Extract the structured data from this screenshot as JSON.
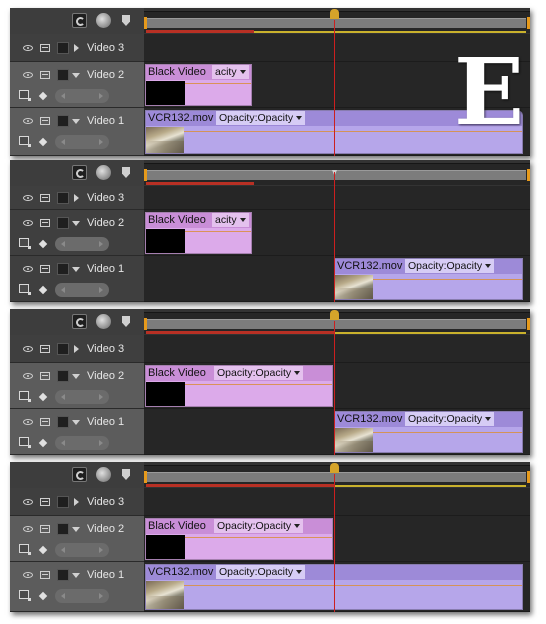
{
  "logo": {
    "letter": "E"
  },
  "panels": [
    {
      "tracks": {
        "video3": {
          "label": "Video 3"
        },
        "video2": {
          "label": "Video 2"
        },
        "video1": {
          "label": "Video 1"
        }
      },
      "clips": {
        "black_video": {
          "name": "Black Video",
          "effect": "acity"
        },
        "vcr132": {
          "name": "VCR132.mov",
          "effect": "Opacity:Opacity"
        }
      }
    },
    {
      "tracks": {
        "video3": {
          "label": "Video 3"
        },
        "video2": {
          "label": "Video 2"
        },
        "video1": {
          "label": "Video 1"
        }
      },
      "clips": {
        "black_video": {
          "name": "Black Video",
          "effect": "acity"
        },
        "vcr132": {
          "name": "VCR132.mov",
          "effect": "Opacity:Opacity"
        }
      }
    },
    {
      "tracks": {
        "video3": {
          "label": "Video 3"
        },
        "video2": {
          "label": "Video 2"
        },
        "video1": {
          "label": "Video 1"
        }
      },
      "clips": {
        "black_video": {
          "name": "Black Video",
          "effect": "Opacity:Opacity"
        },
        "vcr132": {
          "name": "VCR132.mov",
          "effect": "Opacity:Opacity"
        }
      }
    },
    {
      "tracks": {
        "video3": {
          "label": "Video 3"
        },
        "video2": {
          "label": "Video 2"
        },
        "video1": {
          "label": "Video 1"
        }
      },
      "clips": {
        "black_video": {
          "name": "Black Video",
          "effect": "Opacity:Opacity"
        },
        "vcr132": {
          "name": "VCR132.mov",
          "effect": "Opacity:Opacity"
        }
      }
    }
  ],
  "colors": {
    "black_video_clip": "#dcaaea",
    "vcr_clip": "#b6a6ea",
    "playhead": "#cc1f1f",
    "in_out_marker": "#e69a1c"
  }
}
